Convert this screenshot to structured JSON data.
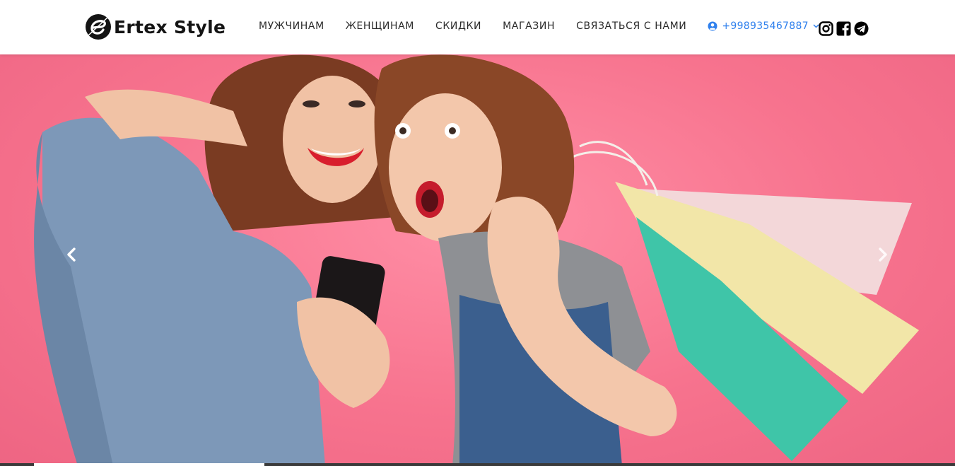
{
  "brand": {
    "name": "Ertex Style",
    "logo_icon": "letter-e-logo"
  },
  "nav": {
    "items": [
      {
        "label": "МУЖЧИНАМ"
      },
      {
        "label": "ЖЕНЩИНАМ"
      },
      {
        "label": "СКИДКИ"
      },
      {
        "label": "МАГАЗИН"
      },
      {
        "label": "СВЯЗАТЬСЯ С НАМИ"
      }
    ],
    "account": {
      "label": "+998935467887",
      "icon": "user-circle-icon",
      "dropdown_icon": "chevron-down-icon",
      "color": "#2f80ed"
    }
  },
  "socials": [
    {
      "name": "instagram",
      "icon": "instagram-icon"
    },
    {
      "name": "facebook",
      "icon": "facebook-icon"
    },
    {
      "name": "telegram",
      "icon": "telegram-icon"
    }
  ],
  "hero": {
    "background_color": "#f7738e",
    "prev_icon": "chevron-left-icon",
    "next_icon": "chevron-right-icon",
    "slide_progress": 0.25
  }
}
